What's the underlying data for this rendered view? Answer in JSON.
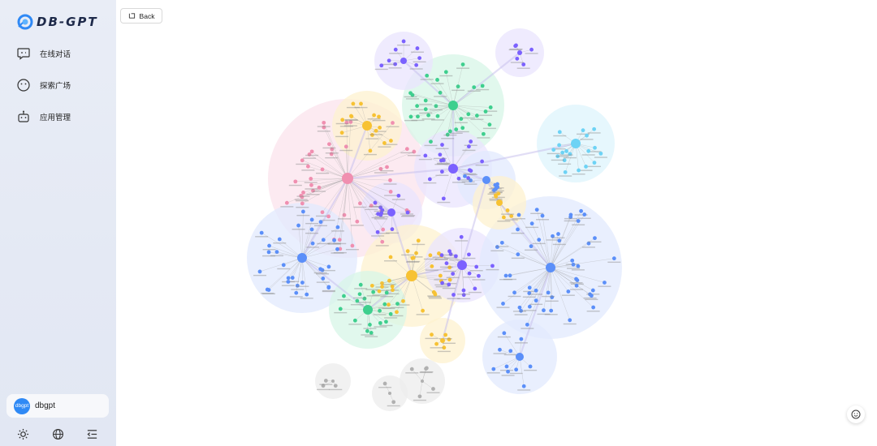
{
  "app": {
    "logo_text": "DB-GPT",
    "brand_color": "#2f89f5"
  },
  "sidebar": {
    "items": [
      {
        "label": "在线对话",
        "icon": "chat-icon"
      },
      {
        "label": "探索广场",
        "icon": "explore-icon"
      },
      {
        "label": "应用管理",
        "icon": "app-manage-icon"
      }
    ],
    "user": {
      "avatar_text": "dbgpt",
      "name": "dbgpt"
    },
    "bottom_icons": [
      "theme-sun-icon",
      "language-globe-icon",
      "collapse-menu-icon"
    ]
  },
  "toolbar": {
    "back_label": "Back",
    "back_icon": "back-arrow-icon"
  },
  "graph": {
    "description_icon": "knowledge-graph",
    "cluster_colors": [
      "#f08fb0",
      "#f7c233",
      "#3ecf8e",
      "#5b8ff9",
      "#7b61ff",
      "#6dd3f5",
      "#b0b0b0"
    ]
  },
  "float_button": {
    "icon": "smile-icon"
  }
}
